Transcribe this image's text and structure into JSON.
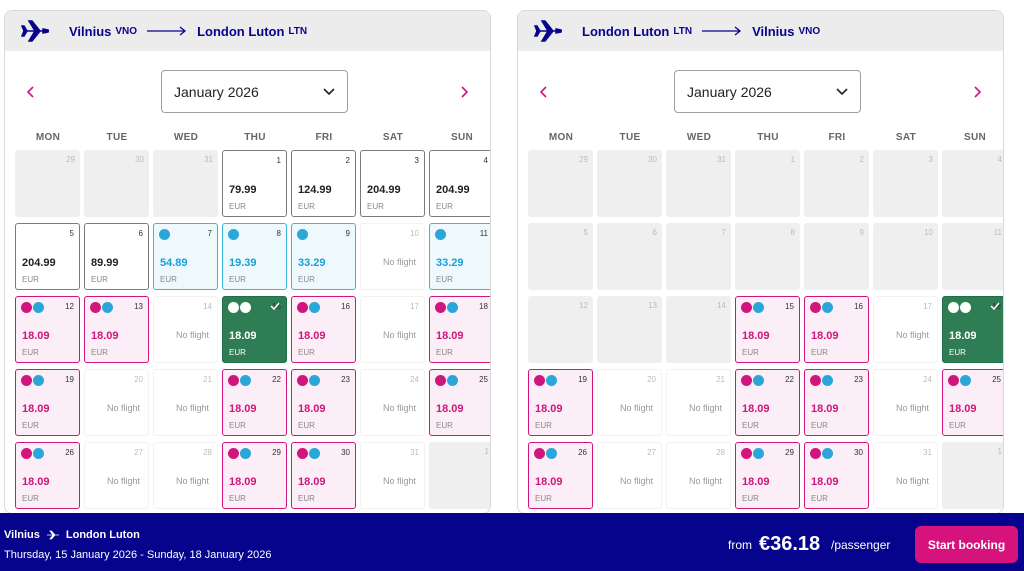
{
  "colors": {
    "brand": "#06038d",
    "pink": "#d0157c",
    "blue": "#2aa7d8",
    "selected": "#2e7d55"
  },
  "weekdays": [
    "MON",
    "TUE",
    "WED",
    "THU",
    "FRI",
    "SAT",
    "SUN"
  ],
  "outbound": {
    "from_city": "Vilnius",
    "from_code": "VNO",
    "to_city": "London Luton",
    "to_code": "LTN",
    "month": "January 2026"
  },
  "inbound": {
    "from_city": "London Luton",
    "from_code": "LTN",
    "to_city": "Vilnius",
    "to_code": "VNO",
    "month": "January 2026"
  },
  "currency": "EUR",
  "no_flight_text": "No flight",
  "outbound_days": [
    {
      "d": "29",
      "t": "dis"
    },
    {
      "d": "30",
      "t": "dis"
    },
    {
      "d": "31",
      "t": "dis"
    },
    {
      "d": "1",
      "t": "norm",
      "p": "79.99"
    },
    {
      "d": "2",
      "t": "norm",
      "p": "124.99"
    },
    {
      "d": "3",
      "t": "norm",
      "p": "204.99"
    },
    {
      "d": "4",
      "t": "norm",
      "p": "204.99"
    },
    {
      "d": "5",
      "t": "norm",
      "p": "204.99"
    },
    {
      "d": "6",
      "t": "norm",
      "p": "89.99"
    },
    {
      "d": "7",
      "t": "blue",
      "p": "54.89"
    },
    {
      "d": "8",
      "t": "blue",
      "p": "19.39"
    },
    {
      "d": "9",
      "t": "blue",
      "p": "33.29"
    },
    {
      "d": "10",
      "t": "none"
    },
    {
      "d": "11",
      "t": "blue",
      "p": "33.29"
    },
    {
      "d": "12",
      "t": "pink",
      "p": "18.09"
    },
    {
      "d": "13",
      "t": "pink",
      "p": "18.09"
    },
    {
      "d": "14",
      "t": "none"
    },
    {
      "d": "15",
      "t": "sel",
      "p": "18.09"
    },
    {
      "d": "16",
      "t": "pink",
      "p": "18.09"
    },
    {
      "d": "17",
      "t": "none"
    },
    {
      "d": "18",
      "t": "pink",
      "p": "18.09"
    },
    {
      "d": "19",
      "t": "pink",
      "p": "18.09"
    },
    {
      "d": "20",
      "t": "none"
    },
    {
      "d": "21",
      "t": "none"
    },
    {
      "d": "22",
      "t": "pink",
      "p": "18.09"
    },
    {
      "d": "23",
      "t": "pink",
      "p": "18.09"
    },
    {
      "d": "24",
      "t": "none"
    },
    {
      "d": "25",
      "t": "pink",
      "p": "18.09"
    },
    {
      "d": "26",
      "t": "pink",
      "p": "18.09"
    },
    {
      "d": "27",
      "t": "none"
    },
    {
      "d": "28",
      "t": "none"
    },
    {
      "d": "29",
      "t": "pink",
      "p": "18.09"
    },
    {
      "d": "30",
      "t": "pink",
      "p": "18.09"
    },
    {
      "d": "31",
      "t": "none"
    },
    {
      "d": "1",
      "t": "dis"
    }
  ],
  "inbound_days": [
    {
      "d": "29",
      "t": "dis"
    },
    {
      "d": "30",
      "t": "dis"
    },
    {
      "d": "31",
      "t": "dis"
    },
    {
      "d": "1",
      "t": "dis"
    },
    {
      "d": "2",
      "t": "dis"
    },
    {
      "d": "3",
      "t": "dis"
    },
    {
      "d": "4",
      "t": "dis"
    },
    {
      "d": "5",
      "t": "dis"
    },
    {
      "d": "6",
      "t": "dis"
    },
    {
      "d": "7",
      "t": "dis"
    },
    {
      "d": "8",
      "t": "dis"
    },
    {
      "d": "9",
      "t": "dis"
    },
    {
      "d": "10",
      "t": "dis"
    },
    {
      "d": "11",
      "t": "dis"
    },
    {
      "d": "12",
      "t": "dis"
    },
    {
      "d": "13",
      "t": "dis"
    },
    {
      "d": "14",
      "t": "dis"
    },
    {
      "d": "15",
      "t": "pink",
      "p": "18.09"
    },
    {
      "d": "16",
      "t": "pink",
      "p": "18.09"
    },
    {
      "d": "17",
      "t": "none"
    },
    {
      "d": "18",
      "t": "sel",
      "p": "18.09"
    },
    {
      "d": "19",
      "t": "pink",
      "p": "18.09"
    },
    {
      "d": "20",
      "t": "none"
    },
    {
      "d": "21",
      "t": "none"
    },
    {
      "d": "22",
      "t": "pink",
      "p": "18.09"
    },
    {
      "d": "23",
      "t": "pink",
      "p": "18.09"
    },
    {
      "d": "24",
      "t": "none"
    },
    {
      "d": "25",
      "t": "pink",
      "p": "18.09"
    },
    {
      "d": "26",
      "t": "pink",
      "p": "18.09"
    },
    {
      "d": "27",
      "t": "none"
    },
    {
      "d": "28",
      "t": "none"
    },
    {
      "d": "29",
      "t": "pink",
      "p": "18.09"
    },
    {
      "d": "30",
      "t": "pink",
      "p": "18.09"
    },
    {
      "d": "31",
      "t": "none"
    },
    {
      "d": "1",
      "t": "dis"
    }
  ],
  "footer": {
    "from_city": "Vilnius",
    "to_city": "London Luton",
    "dates": "Thursday, 15 January 2026 - Sunday, 18 January 2026",
    "from_label": "from",
    "amount": "€36.18",
    "per": "/passenger",
    "button": "Start booking"
  }
}
